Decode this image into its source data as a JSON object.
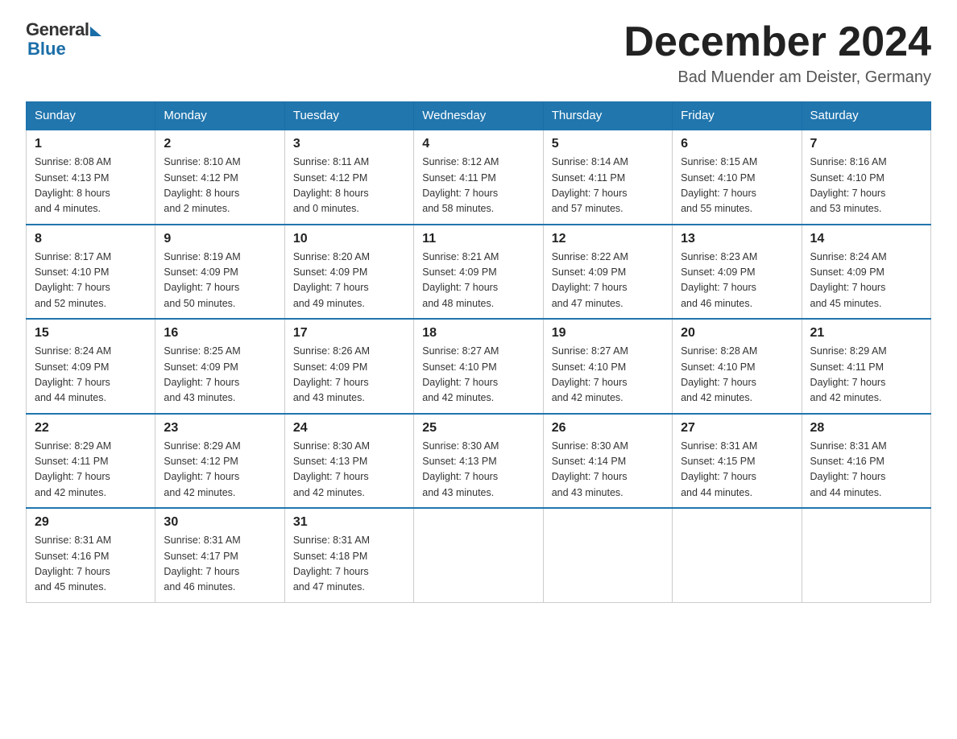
{
  "header": {
    "logo_general": "General",
    "logo_blue": "Blue",
    "month_title": "December 2024",
    "location": "Bad Muender am Deister, Germany"
  },
  "weekdays": [
    "Sunday",
    "Monday",
    "Tuesday",
    "Wednesday",
    "Thursday",
    "Friday",
    "Saturday"
  ],
  "weeks": [
    [
      {
        "day": "1",
        "info": "Sunrise: 8:08 AM\nSunset: 4:13 PM\nDaylight: 8 hours\nand 4 minutes."
      },
      {
        "day": "2",
        "info": "Sunrise: 8:10 AM\nSunset: 4:12 PM\nDaylight: 8 hours\nand 2 minutes."
      },
      {
        "day": "3",
        "info": "Sunrise: 8:11 AM\nSunset: 4:12 PM\nDaylight: 8 hours\nand 0 minutes."
      },
      {
        "day": "4",
        "info": "Sunrise: 8:12 AM\nSunset: 4:11 PM\nDaylight: 7 hours\nand 58 minutes."
      },
      {
        "day": "5",
        "info": "Sunrise: 8:14 AM\nSunset: 4:11 PM\nDaylight: 7 hours\nand 57 minutes."
      },
      {
        "day": "6",
        "info": "Sunrise: 8:15 AM\nSunset: 4:10 PM\nDaylight: 7 hours\nand 55 minutes."
      },
      {
        "day": "7",
        "info": "Sunrise: 8:16 AM\nSunset: 4:10 PM\nDaylight: 7 hours\nand 53 minutes."
      }
    ],
    [
      {
        "day": "8",
        "info": "Sunrise: 8:17 AM\nSunset: 4:10 PM\nDaylight: 7 hours\nand 52 minutes."
      },
      {
        "day": "9",
        "info": "Sunrise: 8:19 AM\nSunset: 4:09 PM\nDaylight: 7 hours\nand 50 minutes."
      },
      {
        "day": "10",
        "info": "Sunrise: 8:20 AM\nSunset: 4:09 PM\nDaylight: 7 hours\nand 49 minutes."
      },
      {
        "day": "11",
        "info": "Sunrise: 8:21 AM\nSunset: 4:09 PM\nDaylight: 7 hours\nand 48 minutes."
      },
      {
        "day": "12",
        "info": "Sunrise: 8:22 AM\nSunset: 4:09 PM\nDaylight: 7 hours\nand 47 minutes."
      },
      {
        "day": "13",
        "info": "Sunrise: 8:23 AM\nSunset: 4:09 PM\nDaylight: 7 hours\nand 46 minutes."
      },
      {
        "day": "14",
        "info": "Sunrise: 8:24 AM\nSunset: 4:09 PM\nDaylight: 7 hours\nand 45 minutes."
      }
    ],
    [
      {
        "day": "15",
        "info": "Sunrise: 8:24 AM\nSunset: 4:09 PM\nDaylight: 7 hours\nand 44 minutes."
      },
      {
        "day": "16",
        "info": "Sunrise: 8:25 AM\nSunset: 4:09 PM\nDaylight: 7 hours\nand 43 minutes."
      },
      {
        "day": "17",
        "info": "Sunrise: 8:26 AM\nSunset: 4:09 PM\nDaylight: 7 hours\nand 43 minutes."
      },
      {
        "day": "18",
        "info": "Sunrise: 8:27 AM\nSunset: 4:10 PM\nDaylight: 7 hours\nand 42 minutes."
      },
      {
        "day": "19",
        "info": "Sunrise: 8:27 AM\nSunset: 4:10 PM\nDaylight: 7 hours\nand 42 minutes."
      },
      {
        "day": "20",
        "info": "Sunrise: 8:28 AM\nSunset: 4:10 PM\nDaylight: 7 hours\nand 42 minutes."
      },
      {
        "day": "21",
        "info": "Sunrise: 8:29 AM\nSunset: 4:11 PM\nDaylight: 7 hours\nand 42 minutes."
      }
    ],
    [
      {
        "day": "22",
        "info": "Sunrise: 8:29 AM\nSunset: 4:11 PM\nDaylight: 7 hours\nand 42 minutes."
      },
      {
        "day": "23",
        "info": "Sunrise: 8:29 AM\nSunset: 4:12 PM\nDaylight: 7 hours\nand 42 minutes."
      },
      {
        "day": "24",
        "info": "Sunrise: 8:30 AM\nSunset: 4:13 PM\nDaylight: 7 hours\nand 42 minutes."
      },
      {
        "day": "25",
        "info": "Sunrise: 8:30 AM\nSunset: 4:13 PM\nDaylight: 7 hours\nand 43 minutes."
      },
      {
        "day": "26",
        "info": "Sunrise: 8:30 AM\nSunset: 4:14 PM\nDaylight: 7 hours\nand 43 minutes."
      },
      {
        "day": "27",
        "info": "Sunrise: 8:31 AM\nSunset: 4:15 PM\nDaylight: 7 hours\nand 44 minutes."
      },
      {
        "day": "28",
        "info": "Sunrise: 8:31 AM\nSunset: 4:16 PM\nDaylight: 7 hours\nand 44 minutes."
      }
    ],
    [
      {
        "day": "29",
        "info": "Sunrise: 8:31 AM\nSunset: 4:16 PM\nDaylight: 7 hours\nand 45 minutes."
      },
      {
        "day": "30",
        "info": "Sunrise: 8:31 AM\nSunset: 4:17 PM\nDaylight: 7 hours\nand 46 minutes."
      },
      {
        "day": "31",
        "info": "Sunrise: 8:31 AM\nSunset: 4:18 PM\nDaylight: 7 hours\nand 47 minutes."
      },
      null,
      null,
      null,
      null
    ]
  ]
}
